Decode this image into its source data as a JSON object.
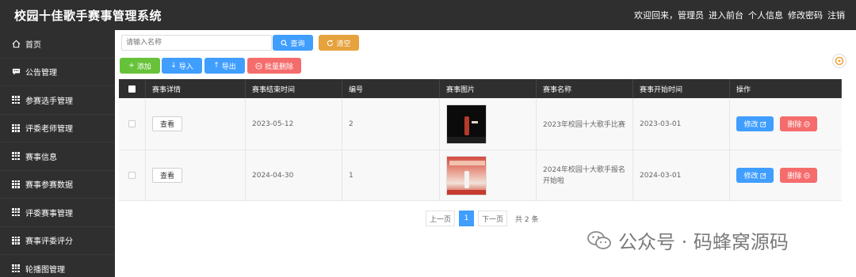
{
  "header": {
    "title": "校园十佳歌手赛事管理系统",
    "welcome": "欢迎回来，管理员",
    "links": [
      "进入前台",
      "个人信息",
      "修改密码",
      "注销"
    ]
  },
  "sidebar": {
    "items": [
      {
        "label": "首页",
        "icon": "home-icon"
      },
      {
        "label": "公告管理",
        "icon": "message-icon"
      },
      {
        "label": "参赛选手管理",
        "icon": "grid-icon"
      },
      {
        "label": "评委老师管理",
        "icon": "grid-icon"
      },
      {
        "label": "赛事信息",
        "icon": "grid-icon"
      },
      {
        "label": "赛事参赛数据",
        "icon": "grid-icon"
      },
      {
        "label": "评委赛事管理",
        "icon": "grid-icon"
      },
      {
        "label": "赛事评委评分",
        "icon": "grid-icon"
      },
      {
        "label": "轮播图管理",
        "icon": "grid-icon"
      }
    ]
  },
  "search": {
    "placeholder": "请输入名称",
    "query_label": "查询",
    "clear_label": "清空"
  },
  "toolbar": {
    "add_label": "添加",
    "import_label": "导入",
    "export_label": "导出",
    "batch_delete_label": "批量删除"
  },
  "table": {
    "columns": [
      "赛事详情",
      "赛事结束时间",
      "编号",
      "赛事图片",
      "赛事名称",
      "赛事开始时间",
      "操作"
    ],
    "rows": [
      {
        "detail": "查看",
        "end_time": "2023-05-12",
        "id": "2",
        "name": "2023年校园十大歌手比赛",
        "start_time": "2023-03-01",
        "edit": "修改",
        "delete": "删除"
      },
      {
        "detail": "查看",
        "end_time": "2024-04-30",
        "id": "1",
        "name": "2024年校园十大歌手报名开始啦",
        "start_time": "2024-03-01",
        "edit": "修改",
        "delete": "删除"
      }
    ]
  },
  "pagination": {
    "prev": "上一页",
    "current": "1",
    "next": "下一页",
    "total": "共 2 条"
  },
  "watermark": {
    "text": "公众号 · 码蜂窝源码"
  },
  "colors": {
    "primary": "#409eff",
    "success": "#67c23a",
    "warning": "#e6a23c",
    "danger": "#f56c6c",
    "dark": "#2f2f2f"
  }
}
